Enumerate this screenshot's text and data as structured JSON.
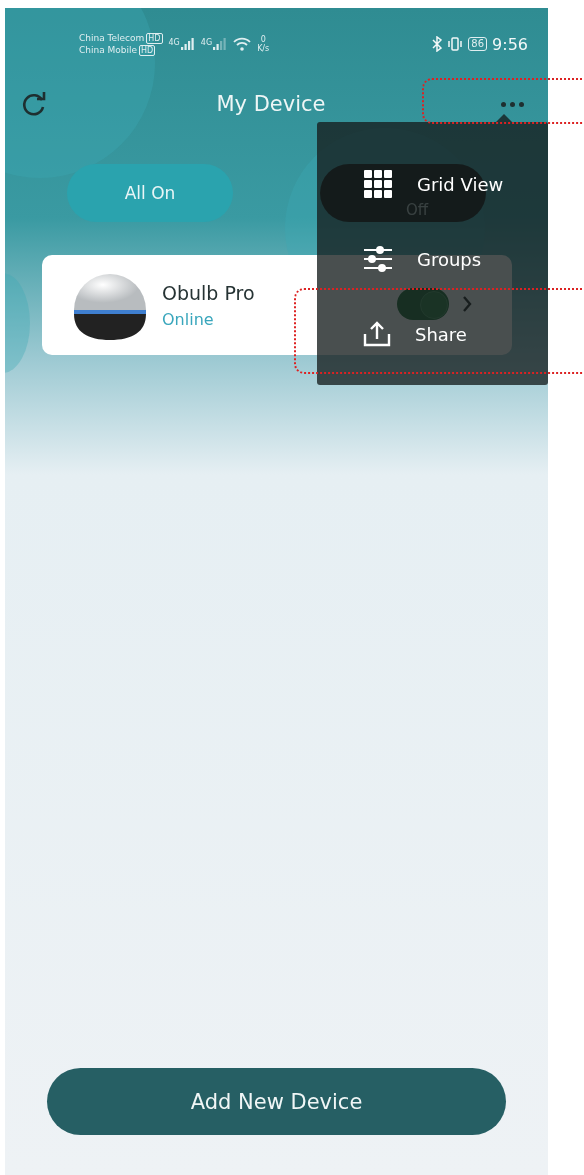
{
  "status_bar": {
    "carrier_1": "China Telecom",
    "carrier_1_badge": "HD",
    "carrier_2": "China Mobile",
    "carrier_2_badge": "HD",
    "network_1": "4G",
    "network_2": "4G",
    "speed_value": "0",
    "speed_unit": "K/s",
    "battery": "86",
    "time": "9:56"
  },
  "header": {
    "title": "My Device",
    "more_highlighted": true
  },
  "actions": [
    {
      "label": "All On",
      "kind": "on"
    },
    {
      "label": "Off",
      "kind": "off"
    }
  ],
  "devices": [
    {
      "name": "Obulb Pro",
      "status": "Online",
      "on": true
    }
  ],
  "menu": {
    "open": true,
    "items": [
      {
        "label": "Grid View",
        "kind": "grid",
        "highlighted": false
      },
      {
        "label": "Groups",
        "kind": "groups",
        "highlighted": false
      },
      {
        "label": "Share",
        "kind": "share",
        "highlighted": true
      }
    ]
  },
  "add_button": "Add New Device"
}
